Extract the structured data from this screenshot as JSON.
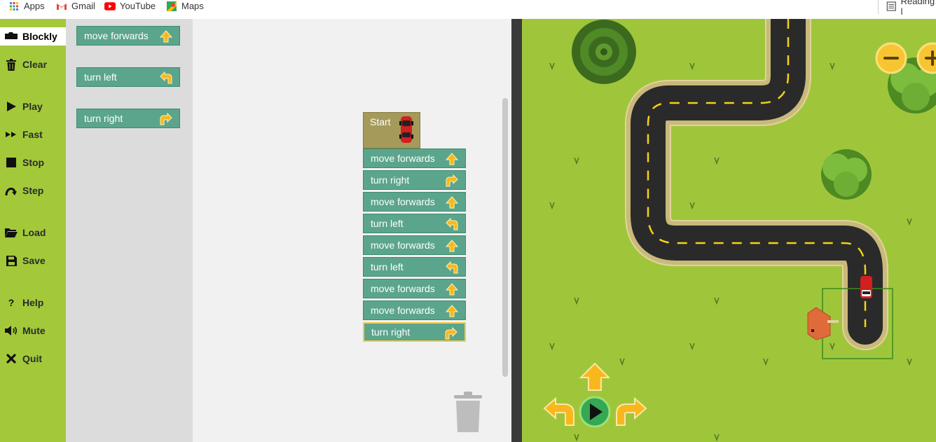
{
  "bookmarks": [
    {
      "label": "Apps",
      "icon": "apps-grid-icon"
    },
    {
      "label": "Gmail",
      "icon": "gmail-icon"
    },
    {
      "label": "YouTube",
      "icon": "youtube-icon"
    },
    {
      "label": "Maps",
      "icon": "maps-icon"
    }
  ],
  "reading_list": "Reading l",
  "sidebar": {
    "items": [
      {
        "label": "Blockly",
        "icon": "blockly-icon"
      },
      {
        "label": "Clear",
        "icon": "trash-icon"
      },
      {
        "label": "Play",
        "icon": "play-icon"
      },
      {
        "label": "Fast",
        "icon": "fast-forward-icon"
      },
      {
        "label": "Stop",
        "icon": "stop-icon"
      },
      {
        "label": "Step",
        "icon": "step-icon"
      },
      {
        "label": "Load",
        "icon": "folder-icon"
      },
      {
        "label": "Save",
        "icon": "save-icon"
      },
      {
        "label": "Help",
        "icon": "help-icon"
      },
      {
        "label": "Mute",
        "icon": "speaker-icon"
      },
      {
        "label": "Quit",
        "icon": "close-icon"
      }
    ]
  },
  "toolbox": {
    "blocks": [
      {
        "label": "move forwards",
        "icon": "arrow-up-icon"
      },
      {
        "label": "turn left",
        "icon": "turn-left-icon"
      },
      {
        "label": "turn right",
        "icon": "turn-right-icon"
      }
    ]
  },
  "program": {
    "start_label": "Start",
    "blocks": [
      {
        "label": "move forwards",
        "icon": "arrow-up-icon"
      },
      {
        "label": "turn right",
        "icon": "turn-right-icon"
      },
      {
        "label": "move forwards",
        "icon": "arrow-up-icon"
      },
      {
        "label": "turn left",
        "icon": "turn-left-icon"
      },
      {
        "label": "move forwards",
        "icon": "arrow-up-icon"
      },
      {
        "label": "turn left",
        "icon": "turn-left-icon"
      },
      {
        "label": "move forwards",
        "icon": "arrow-up-icon"
      },
      {
        "label": "move forwards",
        "icon": "arrow-up-icon"
      },
      {
        "label": "turn right",
        "icon": "turn-right-icon"
      }
    ]
  },
  "colors": {
    "sidebar": "#a3c93a",
    "block": "#5ba58c",
    "start_block": "#a59a5a",
    "grass": "#9fc63b",
    "road": "#2a2a2a",
    "road_edge": "#e2d39b",
    "lane": "#f5d313"
  }
}
